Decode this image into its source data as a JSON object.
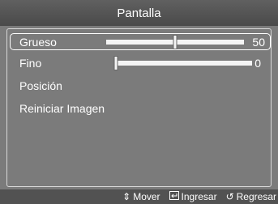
{
  "title": "Pantalla",
  "menu": {
    "items": [
      {
        "label": "Grueso",
        "value": "50",
        "slider": 0.5,
        "selected": true
      },
      {
        "label": "Fino",
        "value": "0",
        "slider": 0.0,
        "selected": false
      },
      {
        "label": "Posición"
      },
      {
        "label": "Reiniciar Imagen"
      }
    ]
  },
  "footer": {
    "move": {
      "icon": "up-down-icon",
      "label": "Mover"
    },
    "enter": {
      "icon": "enter-icon",
      "label": "Ingresar"
    },
    "back": {
      "icon": "return-icon",
      "label": "Regresar"
    }
  }
}
